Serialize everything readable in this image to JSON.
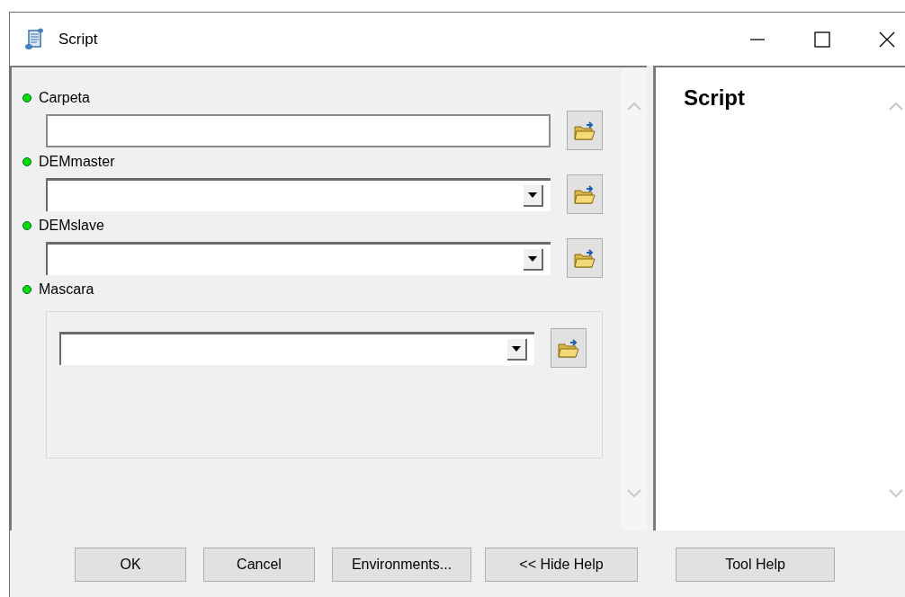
{
  "window": {
    "title": "Script"
  },
  "parameters": [
    {
      "label": "Carpeta",
      "required": true,
      "kind": "text"
    },
    {
      "label": "DEMmaster",
      "required": true,
      "kind": "dropdown"
    },
    {
      "label": "DEMslave",
      "required": true,
      "kind": "dropdown"
    },
    {
      "label": "Mascara",
      "required": true,
      "kind": "grouped_dropdown"
    }
  ],
  "help_panel": {
    "title": "Script"
  },
  "buttons": [
    "OK",
    "Cancel",
    "Environments...",
    "<< Hide Help",
    "Tool Help"
  ]
}
